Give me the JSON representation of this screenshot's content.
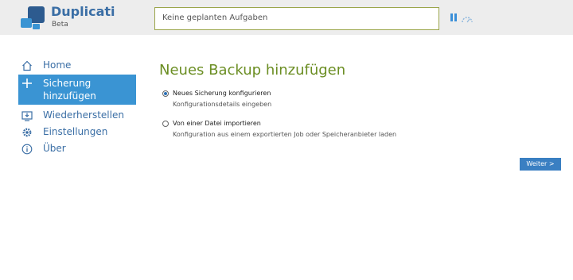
{
  "header": {
    "brand_name": "Duplicati",
    "brand_sub": "Beta",
    "status_text": "Keine geplanten Aufgaben",
    "pause_icon": "pause-icon",
    "throttle_icon": "speedometer-icon",
    "accent_color": "#3a94d3"
  },
  "sidebar": {
    "items": [
      {
        "label": "Home",
        "icon": "home-icon"
      },
      {
        "label": "Sicherung hinzufügen",
        "icon": "plus-icon",
        "active": true
      },
      {
        "label": "Wiederherstellen",
        "icon": "restore-icon"
      },
      {
        "label": "Einstellungen",
        "icon": "gear-icon"
      },
      {
        "label": "Über",
        "icon": "info-icon"
      }
    ]
  },
  "main": {
    "title": "Neues Backup hinzufügen",
    "options": [
      {
        "title": "Neues Sicherung konfigurieren",
        "desc": "Konfigurationsdetails eingeben",
        "selected": true
      },
      {
        "title": "Von einer Datei importieren",
        "desc": "Konfiguration aus einem exportierten Job oder Speicheranbieter laden",
        "selected": false
      }
    ],
    "next_label": "Weiter >"
  }
}
